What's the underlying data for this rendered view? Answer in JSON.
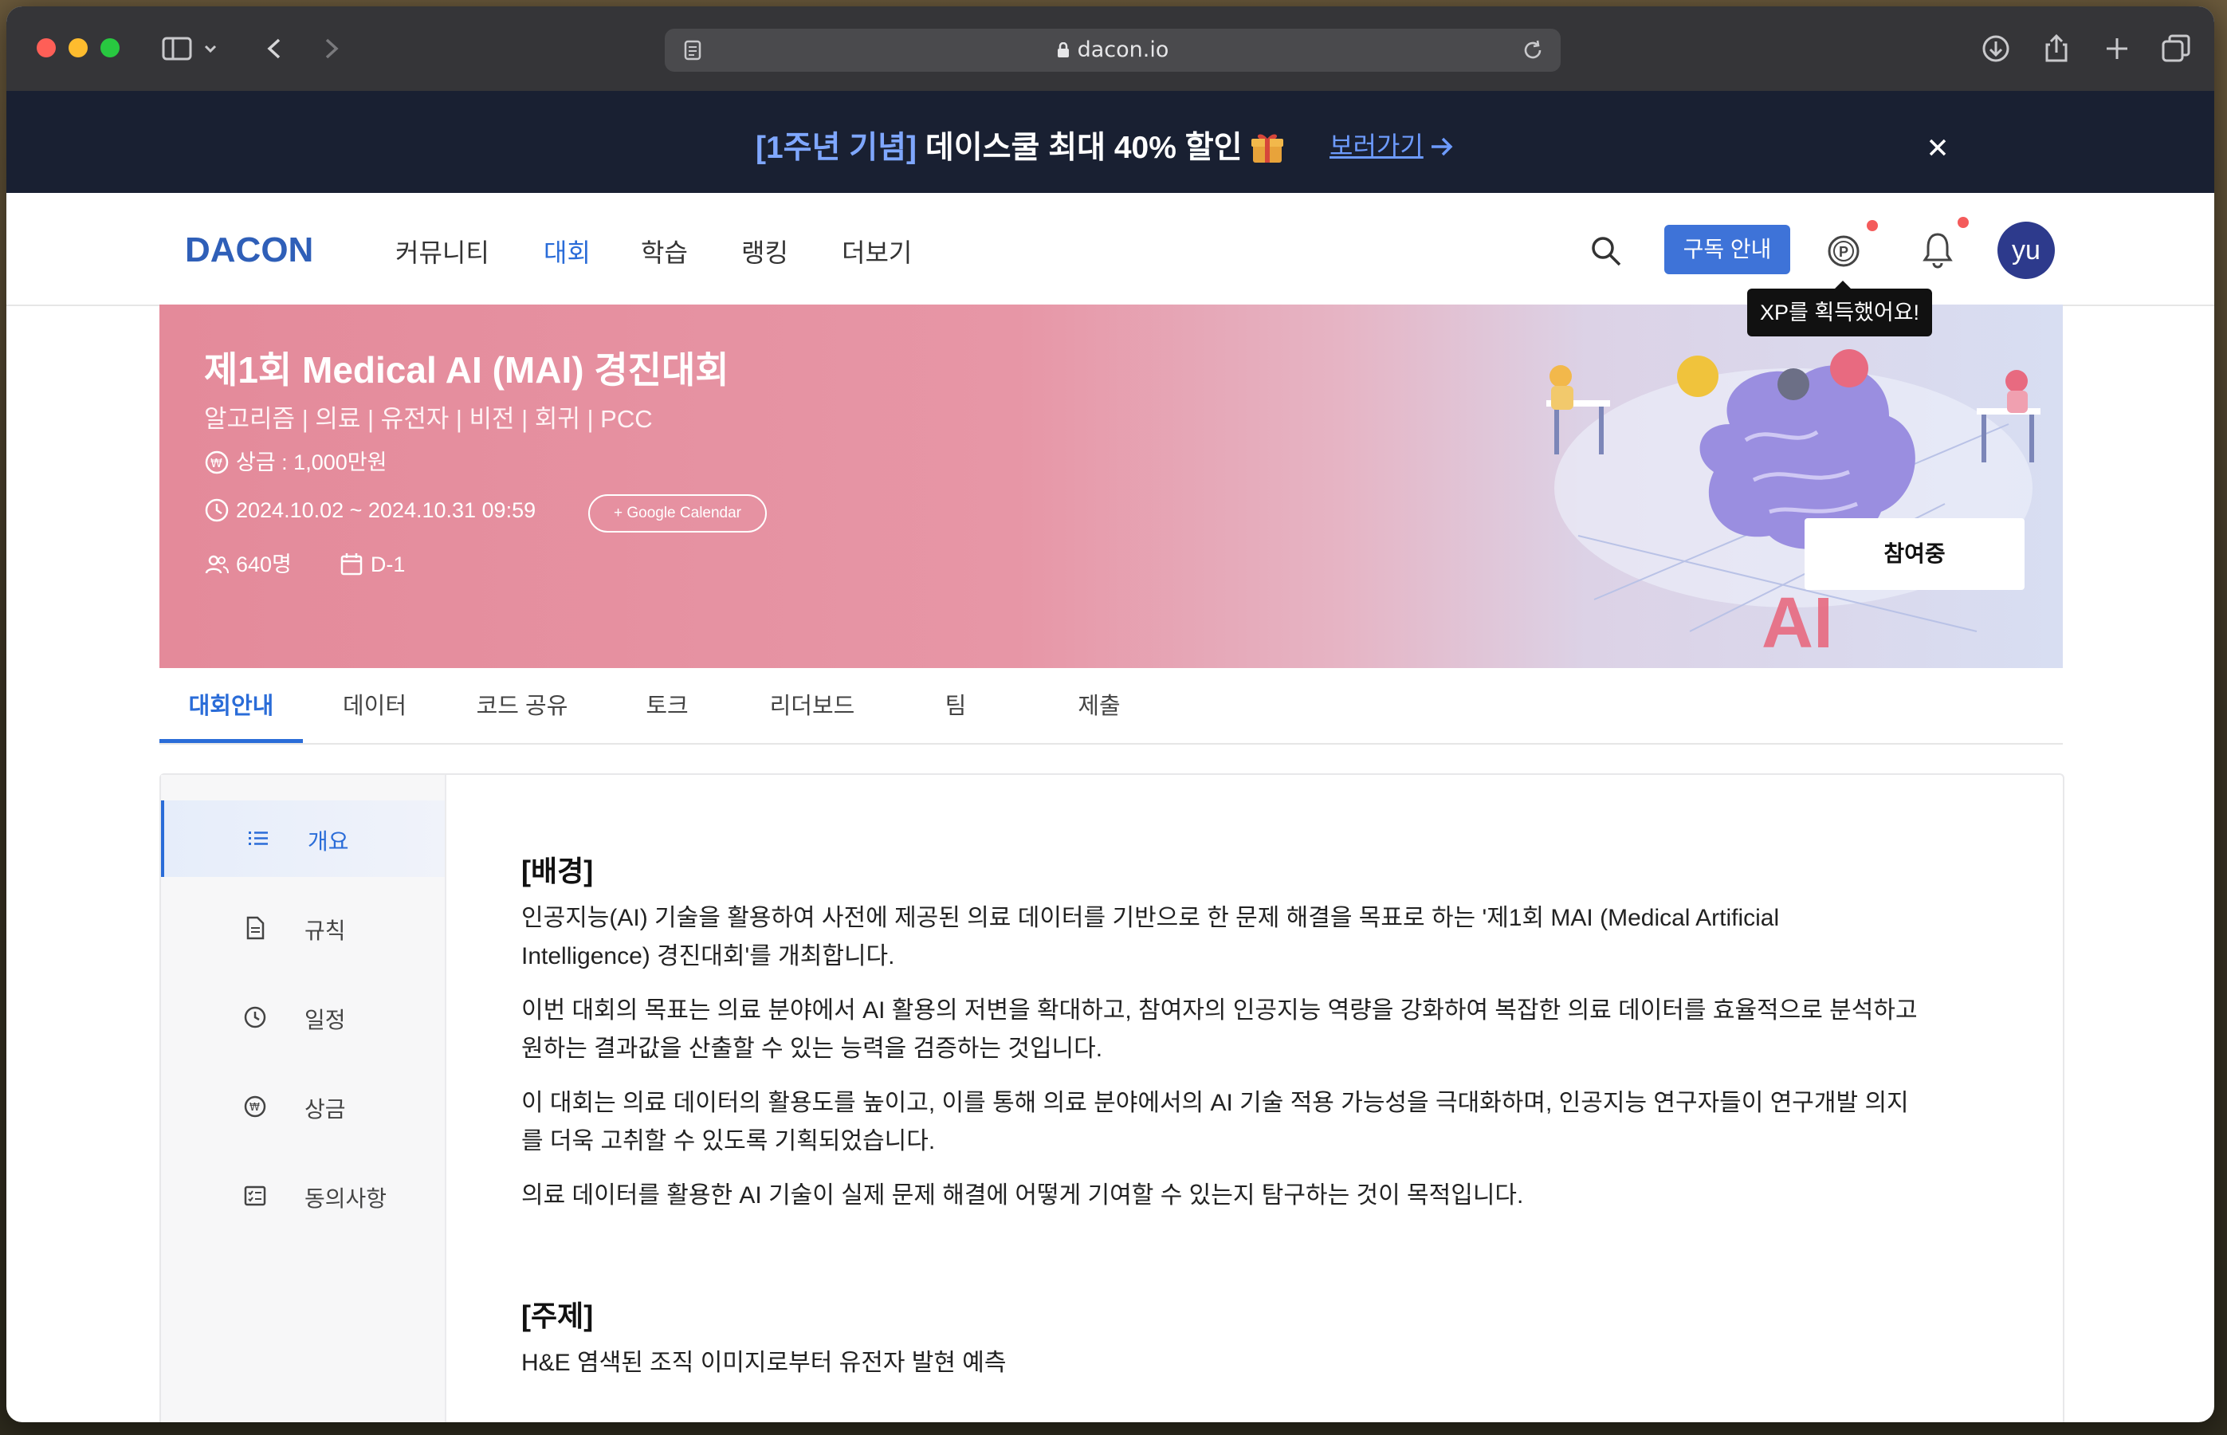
{
  "browser": {
    "url": "dacon.io",
    "icons": [
      "sidebar-icon",
      "chevron-down-icon",
      "back-icon",
      "forward-icon",
      "reader-icon",
      "lock-icon",
      "reload-icon",
      "download-icon",
      "share-icon",
      "new-tab-icon",
      "tabs-overview-icon"
    ]
  },
  "promo": {
    "highlight": "[1주년 기념]",
    "text": " 데이스쿨 최대 40% 할인",
    "link": "보러가기",
    "colors": {
      "background": "#192032",
      "highlight": "#7fa7ff",
      "link": "#6d9bff"
    }
  },
  "nav": {
    "logo": "DACON",
    "items": [
      "커뮤니티",
      "대회",
      "학습",
      "랭킹",
      "더보기"
    ],
    "active": "대회",
    "subscribe": "구독 안내",
    "avatar": "yu",
    "tooltip": "XP를 획득했어요!",
    "accent": "#3e73d8"
  },
  "hero": {
    "title": "제1회 Medical AI (MAI) 경진대회",
    "tags": "알고리즘 | 의료 | 유전자 | 비전 | 회귀 | PCC",
    "prize": "상금 : 1,000만원",
    "period": "2024.10.02 ~ 2024.10.31 09:59",
    "calendar": "+ Google Calendar",
    "participants": "640명",
    "dday": "D-1",
    "join": "참여중"
  },
  "tabs": [
    "대회안내",
    "데이터",
    "코드 공유",
    "토크",
    "리더보드",
    "팀",
    "제출"
  ],
  "sidebar": {
    "items": [
      {
        "label": "개요",
        "icon": "list-icon"
      },
      {
        "label": "규칙",
        "icon": "document-icon"
      },
      {
        "label": "일정",
        "icon": "clock-icon"
      },
      {
        "label": "상금",
        "icon": "won-icon"
      },
      {
        "label": "동의사항",
        "icon": "checklist-icon"
      }
    ]
  },
  "content": {
    "h1": "[배경]",
    "p1a": "인공지능(AI) 기술을 활용하여 사전에 제공된 의료 데이터를 기반으로 한 문제 해결을 목표로 하는 '제1회 MAI (Medical Artificial",
    "p1b": "Intelligence) 경진대회'를 개최합니다.",
    "p2a": "이번 대회의 목표는 의료 분야에서 AI 활용의 저변을 확대하고, 참여자의 인공지능 역량을 강화하여 복잡한 의료 데이터를 효율적으로 분석하고",
    "p2b": "원하는 결과값을 산출할 수 있는 능력을 검증하는 것입니다.",
    "p3a": "이 대회는 의료 데이터의 활용도를 높이고, 이를 통해 의료 분야에서의 AI 기술 적용 가능성을 극대화하며, 인공지능 연구자들이 연구개발 의지",
    "p3b": "를 더욱 고취할 수 있도록 기획되었습니다.",
    "p4": "의료 데이터를 활용한 AI 기술이 실제 문제 해결에 어떻게 기여할 수 있는지 탐구하는 것이 목적입니다.",
    "h2": "[주제]",
    "p5": "H&E 염색된 조직 이미지로부터 유전자 발현 예측"
  }
}
